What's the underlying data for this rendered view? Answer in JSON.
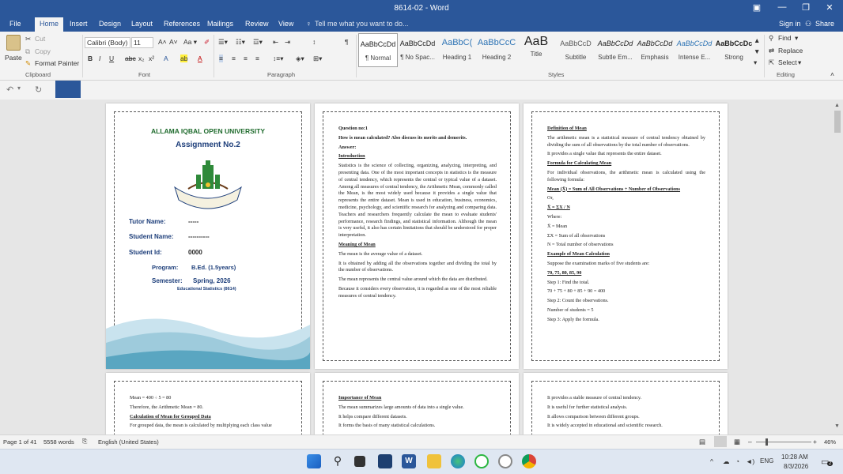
{
  "window": {
    "title": "8614-02 - Word",
    "sign_in": "Sign in",
    "share": "Share"
  },
  "tabs": [
    "File",
    "Home",
    "Insert",
    "Design",
    "Layout",
    "References",
    "Mailings",
    "Review",
    "View"
  ],
  "tell_me": "Tell me what you want to do...",
  "clipboard": {
    "paste": "Paste",
    "cut": "Cut",
    "copy": "Copy",
    "format_painter": "Format Painter",
    "label": "Clipboard"
  },
  "font": {
    "name": "Calibri (Body)",
    "size": "11",
    "label": "Font"
  },
  "paragraph": {
    "label": "Paragraph"
  },
  "styles": {
    "label": "Styles",
    "items": [
      {
        "sample": "AaBbCcDd",
        "name": "¶ Normal"
      },
      {
        "sample": "AaBbCcDd",
        "name": "¶ No Spac..."
      },
      {
        "sample": "AaBbC(",
        "name": "Heading 1"
      },
      {
        "sample": "AaBbCcC",
        "name": "Heading 2"
      },
      {
        "sample": "AaB",
        "name": "Title"
      },
      {
        "sample": "AaBbCcD",
        "name": "Subtitle"
      },
      {
        "sample": "AaBbCcDd",
        "name": "Subtle Em..."
      },
      {
        "sample": "AaBbCcDd",
        "name": "Emphasis"
      },
      {
        "sample": "AaBbCcDd",
        "name": "Intense E..."
      },
      {
        "sample": "AaBbCcDc",
        "name": "Strong"
      }
    ]
  },
  "editing": {
    "find": "Find",
    "replace": "Replace",
    "select": "Select",
    "label": "Editing"
  },
  "cover": {
    "university": "ALLAMA IQBAL OPEN UNIVERSITY",
    "assignment": "Assignment No.2",
    "tutor_label": "Tutor Name:",
    "tutor_value": "-----",
    "student_label": "Student Name:",
    "student_value": "----------",
    "id_label": "Student Id:",
    "id_value": "0000",
    "program_label": "Program:",
    "program_value": "B.Ed. (1.5years)",
    "semester_label": "Semester:",
    "semester_value": "Spring, 2026",
    "course": "Educational Statistics (8614)"
  },
  "page2": {
    "question": "Question no:1",
    "q_text": "How is mean calculated? Also discuss its merits and demerits.",
    "answer": "Answer:",
    "intro_head": "Introduction",
    "intro": "Statistics is the science of collecting, organizing, analyzing, interpreting, and presenting data. One of the most important concepts in statistics is the measure of central tendency, which represents the central or typical value of a dataset. Among all measures of central tendency, the Arithmetic Mean, commonly called the Mean, is the most widely used because it provides a single value that represents the entire dataset. Mean is used in education, business, economics, medicine, psychology, and scientific research for analyzing and comparing data. Teachers and researchers frequently calculate the mean to evaluate students' performance, research findings, and statistical information. Although the mean is very useful, it also has certain limitations that should be understood for proper interpretation.",
    "meaning_head": "Meaning of Mean",
    "m1": "The mean is the average value of a dataset.",
    "m2": "It is obtained by adding all the observations together and dividing the total by the number of observations.",
    "m3": "The mean represents the central value around which the data are distributed.",
    "m4": "Because it considers every observation, it is regarded as one of the most reliable measures of central tendency."
  },
  "page3": {
    "def_head": "Definition of Mean",
    "def": "The arithmetic mean is a statistical measure of central tendency obtained by dividing the sum of all observations by the total number of observations.",
    "single": "It provides a single value that represents the entire dataset.",
    "formula_head": "Formula for Calculating Mean",
    "formula_intro": "For individual observations, the arithmetic mean is calculated using the following formula:",
    "formula": "Mean (X̄) = Sum of All Observations ÷ Number of Observations",
    "or": "Or,",
    "formula2": "X̄ = ΣX / N",
    "where": "Where:",
    "w1": "X̄ = Mean",
    "w2": "ΣX = Sum of all observations",
    "w3": "N = Total number of observations",
    "example_head": "Example of Mean Calculation",
    "example_intro": "Suppose the examination marks of five students are:",
    "marks": "70, 75, 80, 85, 90",
    "s1": "Step 1: Find the total.",
    "s1v": "70 + 75 + 80 + 85 + 90 = 400",
    "s2": "Step 2: Count the observations.",
    "s2v": "Number of students = 5",
    "s3": "Step 3: Apply the formula."
  },
  "page4": {
    "l1": "Mean = 400 ÷ 5 = 80",
    "l2": "Therefore, the Arithmetic Mean = 80.",
    "l3": "Calculation of Mean for Grouped Data",
    "l4": "For grouped data, the mean is calculated by multiplying each class value"
  },
  "page5": {
    "head": "Importance of Mean",
    "l1": "The mean summarizes large amounts of data into a single value.",
    "l2": "It helps compare different datasets.",
    "l3": "It forms the basis of many statistical calculations."
  },
  "page6": {
    "l1": "It provides a stable measure of central tendency.",
    "l2": "It is useful for further statistical analysis.",
    "l3": "It allows comparison between different groups.",
    "l4": "It is widely accepted in educational and scientific research."
  },
  "status": {
    "page": "Page 1 of 41",
    "words": "5558 words",
    "language": "English (United States)",
    "zoom": "46%"
  },
  "taskbar": {
    "time": "10:28 AM",
    "date": "8/3/2026",
    "lang": "ENG",
    "notif": "2"
  },
  "colors": {
    "accent": "#2b579a",
    "cover_green": "#1f6b2d",
    "cover_blue": "#1d3e7a"
  }
}
